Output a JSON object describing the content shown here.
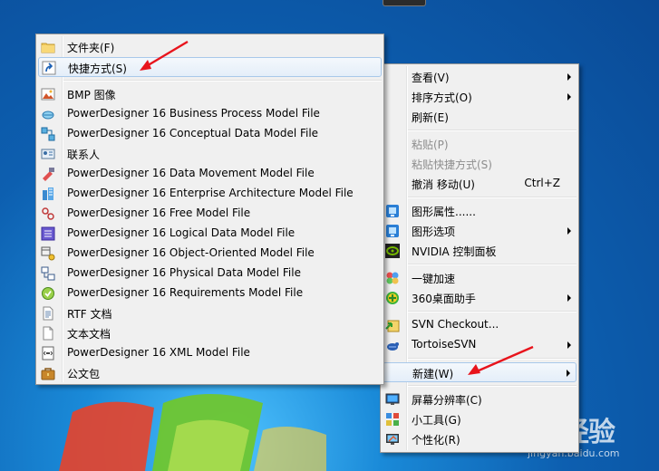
{
  "colors": {
    "accent_red": "#e8141c",
    "menu_bg": "#f0f0f0",
    "highlight_border": "#a8c8ea"
  },
  "context_menu": {
    "items": [
      {
        "label": "查看(V)",
        "has_submenu": true,
        "icon": ""
      },
      {
        "label": "排序方式(O)",
        "has_submenu": true,
        "icon": ""
      },
      {
        "label": "刷新(E)",
        "has_submenu": false,
        "icon": ""
      },
      {
        "label": "粘贴(P)",
        "disabled": true,
        "icon": ""
      },
      {
        "label": "粘贴快捷方式(S)",
        "disabled": true,
        "icon": ""
      },
      {
        "label": "撤消 移动(U)",
        "shortcut": "Ctrl+Z",
        "icon": ""
      },
      {
        "label": "图形属性......",
        "icon": "intel-graphics-icon"
      },
      {
        "label": "图形选项",
        "has_submenu": true,
        "icon": "intel-graphics-icon"
      },
      {
        "label": "NVIDIA 控制面板",
        "icon": "nvidia-icon"
      },
      {
        "label": "一键加速",
        "icon": "speedup-icon"
      },
      {
        "label": "360桌面助手",
        "has_submenu": true,
        "icon": "360-assistant-icon"
      },
      {
        "label": "SVN Checkout...",
        "icon": "svn-checkout-icon"
      },
      {
        "label": "TortoiseSVN",
        "has_submenu": true,
        "icon": "tortoisesvn-icon"
      },
      {
        "label": "新建(W)",
        "has_submenu": true,
        "highlighted": true,
        "icon": ""
      },
      {
        "label": "屏幕分辨率(C)",
        "icon": "screen-resolution-icon"
      },
      {
        "label": "小工具(G)",
        "icon": "gadgets-icon"
      },
      {
        "label": "个性化(R)",
        "icon": "personalize-icon"
      }
    ]
  },
  "new_menu": {
    "items": [
      {
        "label": "文件夹(F)",
        "icon": "folder-icon"
      },
      {
        "label": "快捷方式(S)",
        "icon": "shortcut-icon",
        "highlighted": true
      },
      {
        "label": "BMP 图像",
        "icon": "bmp-image-icon"
      },
      {
        "label": "PowerDesigner 16 Business Process Model File",
        "icon": "bpm-file-icon"
      },
      {
        "label": "PowerDesigner 16 Conceptual Data Model File",
        "icon": "cdm-file-icon"
      },
      {
        "label": "联系人",
        "icon": "contact-icon"
      },
      {
        "label": "PowerDesigner 16 Data Movement Model File",
        "icon": "dmm-file-icon"
      },
      {
        "label": "PowerDesigner 16 Enterprise Architecture Model File",
        "icon": "eam-file-icon"
      },
      {
        "label": "PowerDesigner 16 Free Model File",
        "icon": "free-model-file-icon"
      },
      {
        "label": "PowerDesigner 16 Logical Data Model File",
        "icon": "ldm-file-icon"
      },
      {
        "label": "PowerDesigner 16 Object-Oriented Model File",
        "icon": "oom-file-icon"
      },
      {
        "label": "PowerDesigner 16 Physical Data Model File",
        "icon": "pdm-file-icon"
      },
      {
        "label": "PowerDesigner 16 Requirements Model File",
        "icon": "rqm-file-icon"
      },
      {
        "label": "RTF 文档",
        "icon": "rtf-document-icon"
      },
      {
        "label": "文本文档",
        "icon": "text-document-icon"
      },
      {
        "label": "PowerDesigner 16 XML Model File",
        "icon": "xml-model-file-icon"
      },
      {
        "label": "公文包",
        "icon": "briefcase-icon"
      }
    ]
  },
  "watermark": {
    "logo": "Bai 经验",
    "url": "jingyan.baidu.com"
  }
}
